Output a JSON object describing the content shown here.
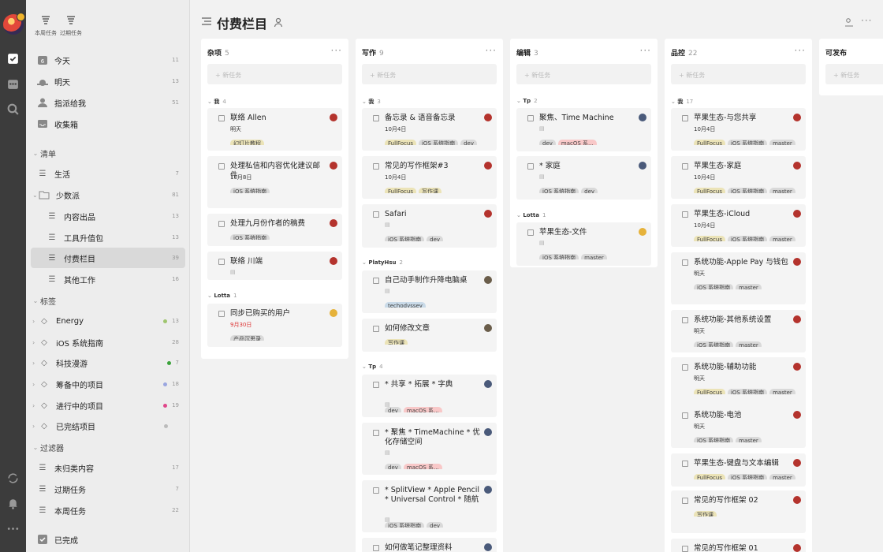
{
  "topbar": {
    "weekly": "本周任务",
    "overdue": "过期任务"
  },
  "nav": [
    {
      "label": "今天",
      "count": "11"
    },
    {
      "label": "明天",
      "count": "13"
    },
    {
      "label": "指派给我",
      "count": "51"
    },
    {
      "label": "收集箱",
      "count": ""
    }
  ],
  "lists": {
    "header": "清单",
    "items": [
      {
        "label": "生活",
        "count": "7"
      },
      {
        "label": "少数派",
        "count": "81"
      },
      {
        "label": "内容出品",
        "count": "13"
      },
      {
        "label": "工具升值包",
        "count": "13"
      },
      {
        "label": "付费栏目",
        "count": "39"
      },
      {
        "label": "其他工作",
        "count": "16"
      }
    ]
  },
  "tags": {
    "header": "标签",
    "items": [
      {
        "label": "Energy",
        "count": "13",
        "color": "#9fc56e"
      },
      {
        "label": "iOS 系统指南",
        "count": "28",
        "color": ""
      },
      {
        "label": "科技漫游",
        "count": "7",
        "color": "#3aa23a"
      },
      {
        "label": "筹备中的项目",
        "count": "18",
        "color": "#9aa6e0"
      },
      {
        "label": "进行中的项目",
        "count": "19",
        "color": "#e0468a"
      },
      {
        "label": "已完结项目",
        "count": "",
        "color": "#bbbbbb"
      }
    ]
  },
  "filters": {
    "header": "过滤器",
    "items": [
      {
        "label": "未归类内容",
        "count": "17"
      },
      {
        "label": "过期任务",
        "count": "7"
      },
      {
        "label": "本周任务",
        "count": "22"
      }
    ]
  },
  "completed": "已完成",
  "title": "付费栏目",
  "new_task": "新任务",
  "columns": [
    {
      "name": "杂项",
      "count": "5",
      "groups": [
        {
          "name": "我",
          "count": "4"
        },
        {
          "name": "Lotta",
          "count": "1"
        }
      ],
      "cards": [
        {
          "title": "联络 Allen",
          "date": "明天",
          "tags": [
            "幻灯片教程"
          ]
        },
        {
          "title": "处理私信和内容优化建议邮件",
          "date": "10月8日",
          "tags": [
            "iOS 系统指南"
          ]
        },
        {
          "title": "处理九月份作者的稿费",
          "date": "",
          "tags": [
            "iOS 系统指南"
          ]
        },
        {
          "title": "联络 川端",
          "date": "",
          "tags": []
        },
        {
          "title": "同步已购买的用户",
          "date": "9月30日",
          "tags": [
            "产品沉思录"
          ]
        }
      ]
    },
    {
      "name": "写作",
      "count": "9",
      "groups": [
        {
          "name": "我",
          "count": "3"
        },
        {
          "name": "PlatyHsu",
          "count": "2"
        },
        {
          "name": "Tp",
          "count": "4"
        }
      ],
      "cards": [
        {
          "title": "备忘录 & 语音备忘录",
          "date": "10月4日",
          "tags": [
            "FullFocus",
            "iOS 系统指南",
            "dev"
          ]
        },
        {
          "title": "常见的写作框架#3",
          "date": "10月4日",
          "tags": [
            "FullFocus",
            "写作课"
          ]
        },
        {
          "title": "Safari",
          "date": "",
          "tags": [
            "iOS 系统指南",
            "dev"
          ]
        },
        {
          "title": "自己动手制作升降电脑桌",
          "date": "",
          "tags": [
            "techodyssey"
          ]
        },
        {
          "title": "如何修改文章",
          "date": "",
          "tags": [
            "写作课"
          ]
        },
        {
          "title": "* 共享 * 拓展 * 字典",
          "date": "",
          "tags": [
            "dev",
            "macOS 系..."
          ]
        },
        {
          "title": "* 聚焦 * TimeMachine * 优化存储空间",
          "date": "",
          "tags": [
            "dev",
            "macOS 系..."
          ]
        },
        {
          "title": "* SplitView * Apple Pencil * Universal Control * 随航",
          "date": "",
          "tags": [
            "iOS 系统指南",
            "dev"
          ]
        },
        {
          "title": "如何做笔记整理资料",
          "date": "",
          "tags": []
        }
      ]
    },
    {
      "name": "编辑",
      "count": "3",
      "groups": [
        {
          "name": "Tp",
          "count": "2"
        },
        {
          "name": "Lotta",
          "count": "1"
        }
      ],
      "cards": [
        {
          "title": "聚焦、Time Machine",
          "date": "",
          "tags": [
            "dev",
            "macOS 系..."
          ]
        },
        {
          "title": "* 家庭",
          "date": "",
          "tags": [
            "iOS 系统指南",
            "dev"
          ]
        },
        {
          "title": "苹果生态-文件",
          "date": "",
          "tags": [
            "iOS 系统指南",
            "master"
          ]
        }
      ]
    },
    {
      "name": "品控",
      "count": "22",
      "groups": [
        {
          "name": "我",
          "count": "17"
        }
      ],
      "cards": [
        {
          "title": "苹果生态-与您共享",
          "date": "10月4日",
          "tags": [
            "FullFocus",
            "iOS 系统指南",
            "master"
          ]
        },
        {
          "title": "苹果生态-家庭",
          "date": "10月4日",
          "tags": [
            "FullFocus",
            "iOS 系统指南",
            "master"
          ]
        },
        {
          "title": "苹果生态-iCloud",
          "date": "10月4日",
          "tags": [
            "FullFocus",
            "iOS 系统指南",
            "master"
          ]
        },
        {
          "title": "系统功能-Apple Pay 与钱包",
          "date": "明天",
          "tags": [
            "iOS 系统指南",
            "master"
          ]
        },
        {
          "title": "系统功能-其他系统设置",
          "date": "明天",
          "tags": [
            "iOS 系统指南",
            "master"
          ]
        },
        {
          "title": "系统功能-辅助功能",
          "date": "明天",
          "tags": [
            "FullFocus",
            "iOS 系统指南",
            "master"
          ]
        },
        {
          "title": "系统功能-电池",
          "date": "明天",
          "tags": [
            "iOS 系统指南",
            "master"
          ]
        },
        {
          "title": "苹果生态-键盘与文本编辑",
          "date": "",
          "tags": [
            "FullFocus",
            "iOS 系统指南",
            "master"
          ]
        },
        {
          "title": "常见的写作框架 02",
          "date": "",
          "tags": [
            "写作课"
          ]
        },
        {
          "title": "常见的写作框架 01",
          "date": "",
          "tags": []
        }
      ]
    },
    {
      "name": "可发布",
      "count": "",
      "groups": [],
      "cards": []
    }
  ]
}
